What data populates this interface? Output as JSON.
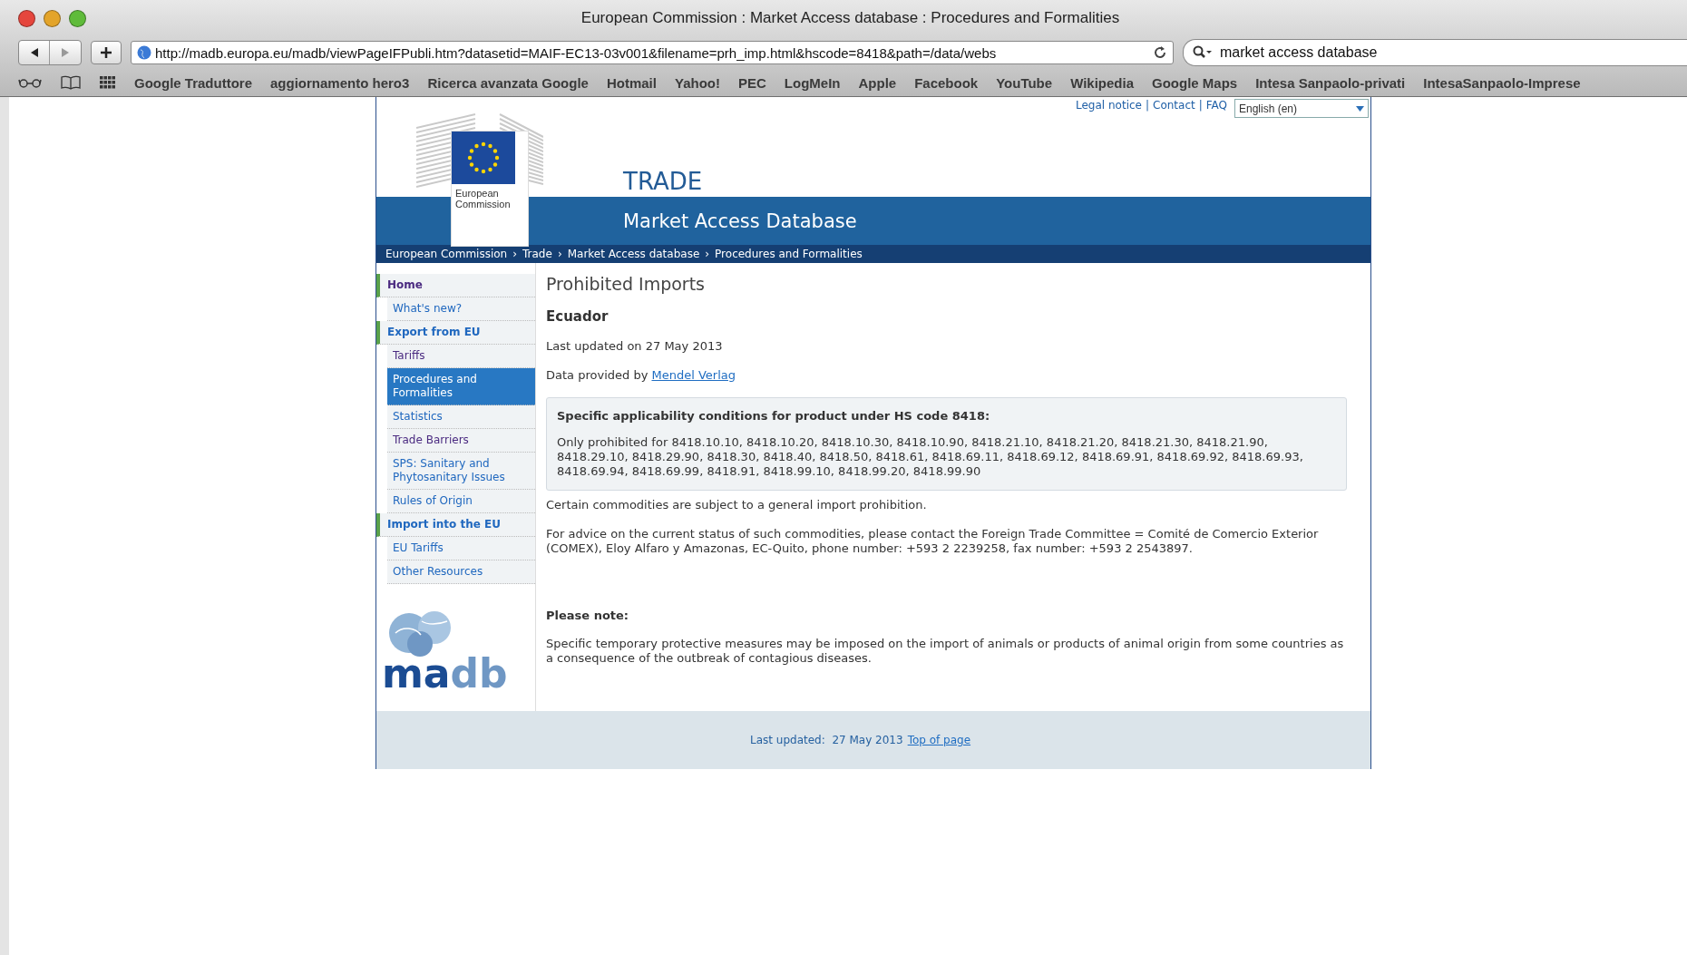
{
  "window": {
    "title": "European Commission : Market Access database : Procedures and Formalities"
  },
  "toolbar": {
    "url": "http://madb.europa.eu/madb/viewPageIFPubli.htm?datasetid=MAIF-EC13-03v001&filename=prh_imp.html&hscode=8418&path=/data/webs",
    "search": "market access database"
  },
  "bookmarks": [
    "Google Traduttore",
    "aggiornamento hero3",
    "Ricerca avanzata Google",
    "Hotmail",
    "Yahoo!",
    "PEC",
    "LogMeIn",
    "Apple",
    "Facebook",
    "YouTube",
    "Wikipedia",
    "Google Maps",
    "Intesa Sanpaolo-privati",
    "IntesaSanpaolo-Imprese"
  ],
  "header": {
    "top_links": [
      {
        "label": "Legal notice"
      },
      {
        "separator": "|",
        "label": "Contact"
      },
      {
        "separator": "|",
        "label": "FAQ"
      }
    ],
    "language": "English (en)",
    "logo_text": "European Commission",
    "section": "TRADE",
    "site_name": "Market Access Database"
  },
  "breadcrumb": [
    {
      "label": "European Commission"
    },
    {
      "separator": "›",
      "label": "Trade"
    },
    {
      "separator": "›",
      "label": "Market Access database"
    },
    {
      "separator": "›",
      "label": "Procedures and Formalities"
    }
  ],
  "sidebar": {
    "items": [
      {
        "kind": "section",
        "label": "Home",
        "selected": false,
        "visited": true
      },
      {
        "kind": "sub",
        "label": "What's new?",
        "selected": false,
        "visited": false
      },
      {
        "kind": "section",
        "label": "Export from EU",
        "selected": false,
        "visited": false
      },
      {
        "kind": "sub",
        "label": "Tariffs",
        "selected": false,
        "visited": true
      },
      {
        "kind": "sub",
        "label": "Procedures and Formalities",
        "selected": true,
        "visited": false
      },
      {
        "kind": "sub",
        "label": "Statistics",
        "selected": false,
        "visited": false
      },
      {
        "kind": "sub",
        "label": "Trade Barriers",
        "selected": false,
        "visited": true
      },
      {
        "kind": "sub",
        "label": "SPS: Sanitary and Phytosanitary Issues",
        "selected": false,
        "visited": false
      },
      {
        "kind": "sub",
        "label": "Rules of Origin",
        "selected": false,
        "visited": false
      },
      {
        "kind": "section",
        "label": "Import into the EU",
        "selected": false,
        "visited": false
      },
      {
        "kind": "sub",
        "label": "EU Tariffs",
        "selected": false,
        "visited": false
      },
      {
        "kind": "sub",
        "label": "Other Resources",
        "selected": false,
        "visited": false
      }
    ],
    "logo_text": "madb"
  },
  "content": {
    "title": "Prohibited Imports",
    "country": "Ecuador",
    "last_updated": "Last updated on 27 May 2013",
    "provider_label": "Data provided by",
    "provider_link": "Mendel Verlag",
    "conditions_title": "Specific applicability conditions for product under HS code 8418:",
    "conditions_text": "Only prohibited for 8418.10.10, 8418.10.20, 8418.10.30, 8418.10.90, 8418.21.10, 8418.21.20, 8418.21.30, 8418.21.90, 8418.29.10, 8418.29.90, 8418.30, 8418.40, 8418.50, 8418.61, 8418.69.11, 8418.69.12, 8418.69.91, 8418.69.92, 8418.69.93, 8418.69.94, 8418.69.99, 8418.91, 8418.99.10, 8418.99.20, 8418.99.90",
    "paragraphs": [
      "Certain commodities are subject to a general import prohibition.",
      "For advice on the current status of such commodities, please contact the Foreign Trade Committee = Comité de Comercio Exterior (COMEX), Eloy Alfaro y Amazonas, EC-Quito, phone number: +593 2 2239258, fax number: +593 2 2543897."
    ],
    "note_title": "Please note:",
    "note_text": "Specific temporary protective measures may be imposed on the import of animals or products of animal origin from some countries as a consequence of the outbreak of contagious diseases."
  },
  "footer": {
    "text": "Last updated:  27 May 2013",
    "link": "Top of page"
  }
}
